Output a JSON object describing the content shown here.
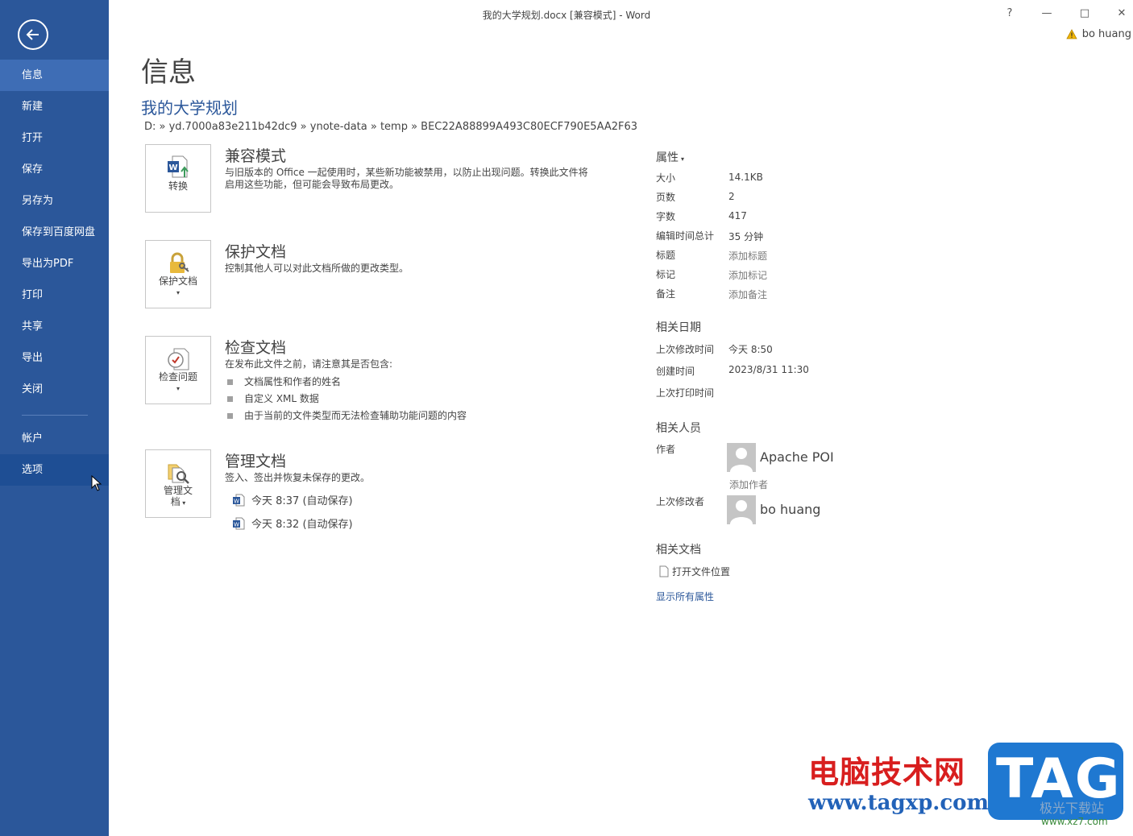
{
  "window": {
    "title": "我的大学规划.docx [兼容模式] - Word",
    "help": "?",
    "minimize": "—",
    "maximize": "□",
    "close": "✕",
    "user_name": "bo huang"
  },
  "sidebar": {
    "items": [
      {
        "label": "信息"
      },
      {
        "label": "新建"
      },
      {
        "label": "打开"
      },
      {
        "label": "保存"
      },
      {
        "label": "另存为"
      },
      {
        "label": "保存到百度网盘"
      },
      {
        "label": "导出为PDF"
      },
      {
        "label": "打印"
      },
      {
        "label": "共享"
      },
      {
        "label": "导出"
      },
      {
        "label": "关闭"
      },
      {
        "label": "帐户"
      },
      {
        "label": "选项"
      }
    ],
    "active_index": 0
  },
  "main": {
    "page_title": "信息",
    "doc_name": "我的大学规划",
    "doc_path": "D: » yd.7000a83e211b42dc9 » ynote-data » temp » BEC22A88899A493C80ECF790E5AA2F63",
    "sections": {
      "compat": {
        "button_label": "转换",
        "title": "兼容模式",
        "desc_line1": "与旧版本的 Office 一起使用时，某些新功能被禁用，以防止出现问题。转换此文件将",
        "desc_line2": "启用这些功能，但可能会导致布局更改。"
      },
      "protect": {
        "button_label": "保护文档",
        "title": "保护文档",
        "desc": "控制其他人可以对此文档所做的更改类型。"
      },
      "inspect": {
        "button_label": "检查问题",
        "title": "检查文档",
        "desc": "在发布此文件之前，请注意其是否包含:",
        "bullets": [
          "文档属性和作者的姓名",
          "自定义 XML 数据",
          "由于当前的文件类型而无法检查辅助功能问题的内容"
        ]
      },
      "manage": {
        "button_label_1": "管理文",
        "button_label_2": "档",
        "title": "管理文档",
        "desc": "签入、签出并恢复未保存的更改。",
        "versions": [
          "今天 8:37 (自动保存)",
          "今天 8:32 (自动保存)"
        ]
      }
    }
  },
  "properties": {
    "heading": "属性",
    "rows": [
      {
        "key": "大小",
        "value": "14.1KB"
      },
      {
        "key": "页数",
        "value": "2"
      },
      {
        "key": "字数",
        "value": "417"
      },
      {
        "key": "编辑时间总计",
        "value": "35 分钟"
      },
      {
        "key": "标题",
        "value": "添加标题"
      },
      {
        "key": "标记",
        "value": "添加标记"
      },
      {
        "key": "备注",
        "value": "添加备注"
      }
    ],
    "dates_heading": "相关日期",
    "dates": [
      {
        "key": "上次修改时间",
        "value": "今天 8:50"
      },
      {
        "key": "创建时间",
        "value": "2023/8/31 11:30"
      },
      {
        "key": "上次打印时间",
        "value": ""
      }
    ],
    "people_heading": "相关人员",
    "author_label": "作者",
    "author_name": "Apache POI",
    "add_author": "添加作者",
    "last_modified_by_label": "上次修改者",
    "last_modified_by": "bo huang",
    "related_docs_heading": "相关文档",
    "open_location": "打开文件位置",
    "show_all": "显示所有属性"
  },
  "watermark": {
    "line1": "电脑技术网",
    "line2": "www.tagxp.com",
    "tag": "TAG",
    "jiguang": "极光下载站",
    "url2": "www.xz7.com"
  },
  "colors": {
    "sidebar_bg": "#2b579a",
    "accent": "#2b579a",
    "active_item": "#3e6db5"
  }
}
